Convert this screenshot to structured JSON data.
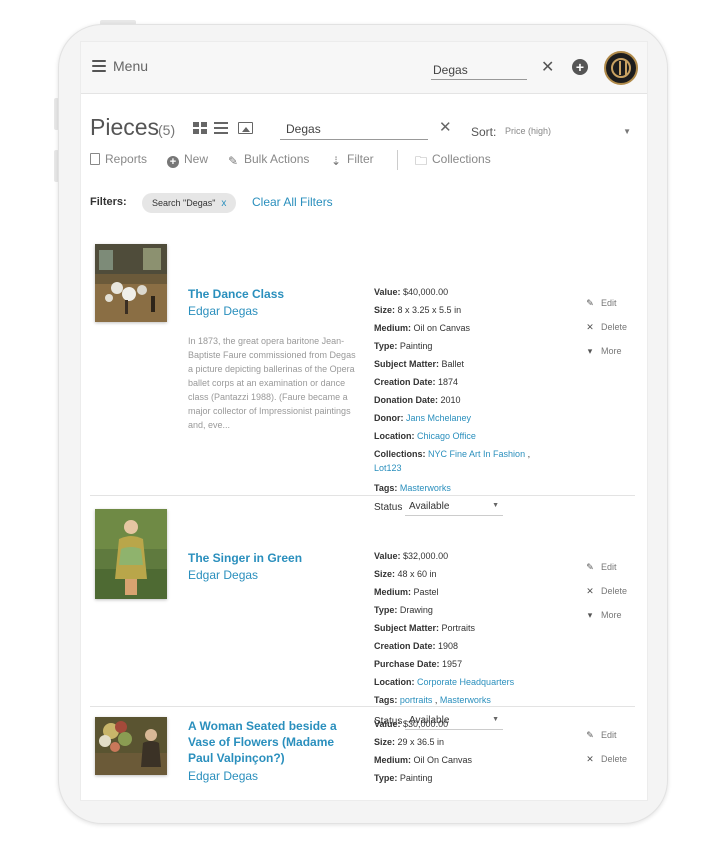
{
  "topbar": {
    "menu_label": "Menu",
    "search_value": "Degas",
    "clear_icon": "close-icon",
    "add_icon": "plus-circle-icon",
    "avatar_icon": "logo-avatar"
  },
  "header": {
    "title": "Pieces",
    "count": "(5)",
    "search_value": "Degas",
    "sort_label": "Sort:",
    "sort_value": "Price (high)"
  },
  "toolbar": {
    "reports": "Reports",
    "new": "New",
    "bulk_actions": "Bulk Actions",
    "filter": "Filter",
    "collections": "Collections"
  },
  "filters": {
    "label": "Filters:",
    "chip": "Search \"Degas\"",
    "chip_remove": "x",
    "clear_all": "Clear All Filters"
  },
  "actions": {
    "edit": "Edit",
    "delete": "Delete",
    "more": "More"
  },
  "items": [
    {
      "title": "The Dance Class",
      "artist": "Edgar Degas",
      "description": "In 1873, the great opera baritone Jean-Baptiste Faure commissioned from Degas a picture depicting ballerinas of the Opera ballet corps at an examination or dance class (Pantazzi 1988). (Faure became a major collector of Impressionist paintings and, eve...",
      "value_label": "Value:",
      "value": "$40,000.00",
      "size_label": "Size:",
      "size": "8 x 3.25 x 5.5 in",
      "medium_label": "Medium:",
      "medium": "Oil on Canvas",
      "type_label": "Type:",
      "type": "Painting",
      "subject_label": "Subject Matter:",
      "subject": "Ballet",
      "creation_label": "Creation Date:",
      "creation": "1874",
      "donation_label": "Donation Date:",
      "donation": "2010",
      "donor_label": "Donor:",
      "donor": "Jans Mchelaney",
      "location_label": "Location:",
      "location": "Chicago Office",
      "collections_label": "Collections:",
      "collection_1": "NYC Fine Art In Fashion",
      "collection_sep": ",",
      "collection_2": "Lot123",
      "tags_label": "Tags:",
      "tag_1": "Masterworks",
      "status_label": "Status",
      "status": "Available"
    },
    {
      "title": "The Singer in Green",
      "artist": "Edgar Degas",
      "value_label": "Value:",
      "value": "$32,000.00",
      "size_label": "Size:",
      "size": "48 x 60 in",
      "medium_label": "Medium:",
      "medium": "Pastel",
      "type_label": "Type:",
      "type": "Drawing",
      "subject_label": "Subject Matter:",
      "subject": "Portraits",
      "creation_label": "Creation Date:",
      "creation": "1908",
      "purchase_label": "Purchase Date:",
      "purchase": "1957",
      "location_label": "Location:",
      "location": "Corporate Headquarters",
      "tags_label": "Tags:",
      "tag_1": "portraits",
      "tag_sep": ",",
      "tag_2": "Masterworks",
      "status_label": "Status",
      "status": "Available"
    },
    {
      "title": "A Woman Seated beside a Vase of Flowers (Madame Paul Valpinçon?)",
      "artist": "Edgar Degas",
      "value_label": "Value:",
      "value": "$30,000.00",
      "size_label": "Size:",
      "size": "29 x 36.5 in",
      "medium_label": "Medium:",
      "medium": "Oil On Canvas",
      "type_label": "Type:",
      "type": "Painting"
    }
  ],
  "colors": {
    "link": "#2a8fbd",
    "topbar_bg": "#f7f7f7",
    "device_frame": "#f4f4f4"
  }
}
